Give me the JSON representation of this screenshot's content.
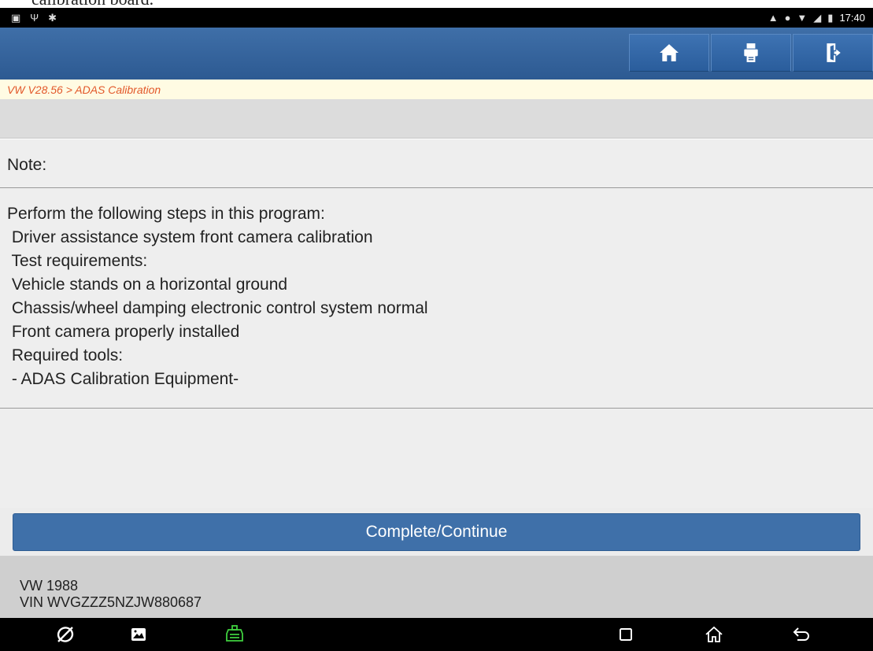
{
  "document": {
    "caption_fragment": "calibration board."
  },
  "status_bar": {
    "time": "17:40"
  },
  "toolbar": {
    "buttons": [
      {
        "name": "home",
        "icon": "home-icon"
      },
      {
        "name": "print",
        "icon": "printer-icon"
      },
      {
        "name": "exit",
        "icon": "exit-icon"
      }
    ]
  },
  "breadcrumb": {
    "text": "VW V28.56 > ADAS Calibration"
  },
  "note": {
    "label": "Note:"
  },
  "instructions": {
    "lines": [
      "Perform the following steps in this program:",
      " Driver assistance system front camera calibration",
      " Test requirements:",
      " Vehicle stands on a horizontal ground",
      " Chassis/wheel damping electronic control system normal",
      " Front camera properly installed",
      " Required tools:",
      " - ADAS Calibration Equipment-"
    ]
  },
  "continue_button": {
    "label": "Complete/Continue"
  },
  "vehicle": {
    "model": "VW  1988",
    "vin": "VIN WVGZZZ5NZJW880687"
  },
  "colors": {
    "toolbar_blue": "#2d5a92",
    "button_blue": "#3f70a9",
    "breadcrumb_text": "#e2582a",
    "breadcrumb_bg": "#fffbe3",
    "vci_green": "#3fcf3f"
  }
}
